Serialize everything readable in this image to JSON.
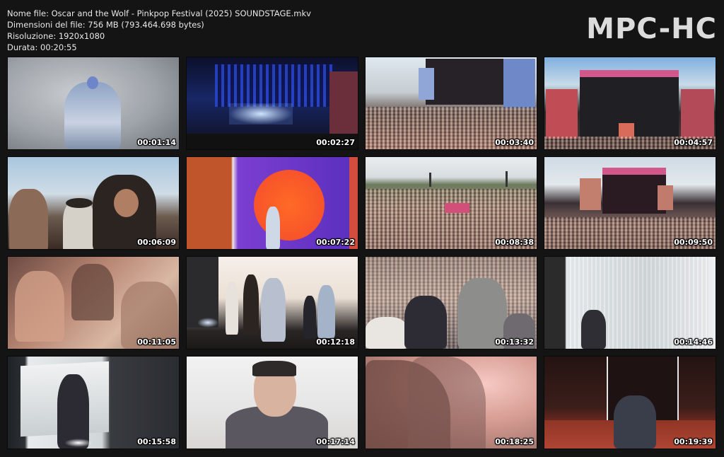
{
  "info": {
    "file_name": "Nome file: Oscar and the Wolf - Pinkpop Festival (2025) SOUNDSTAGE.mkv",
    "file_size": "Dimensioni del file: 756 MB (793.464.698 bytes)",
    "resolution": "Risoluzione: 1920x1080",
    "duration": "Durata: 00:20:55"
  },
  "brand": "MPC-HC",
  "thumbnails": [
    {
      "timestamp": "00:01:14"
    },
    {
      "timestamp": "00:02:27"
    },
    {
      "timestamp": "00:03:40"
    },
    {
      "timestamp": "00:04:57"
    },
    {
      "timestamp": "00:06:09"
    },
    {
      "timestamp": "00:07:22"
    },
    {
      "timestamp": "00:08:38"
    },
    {
      "timestamp": "00:09:50"
    },
    {
      "timestamp": "00:11:05"
    },
    {
      "timestamp": "00:12:18"
    },
    {
      "timestamp": "00:13:32"
    },
    {
      "timestamp": "00:14:46"
    },
    {
      "timestamp": "00:15:58"
    },
    {
      "timestamp": "00:17:14"
    },
    {
      "timestamp": "00:18:25"
    },
    {
      "timestamp": "00:19:39"
    }
  ]
}
